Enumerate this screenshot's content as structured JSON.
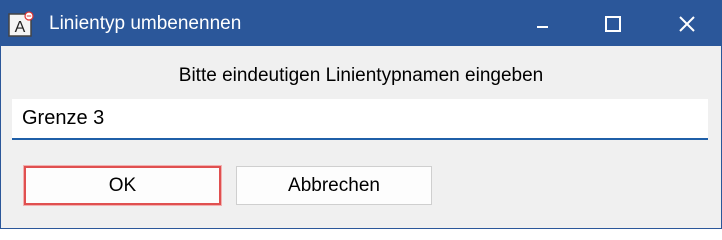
{
  "window": {
    "title": "Linientyp umbenennen",
    "app_icon_letter": "A"
  },
  "dialog": {
    "prompt": "Bitte eindeutigen Linientypnamen eingeben",
    "name_value": "Grenze 3",
    "ok_label": "OK",
    "cancel_label": "Abbrechen"
  },
  "colors": {
    "titlebar": "#2b579a",
    "focus_highlight": "#e05050",
    "input_underline": "#1f5fa8"
  }
}
